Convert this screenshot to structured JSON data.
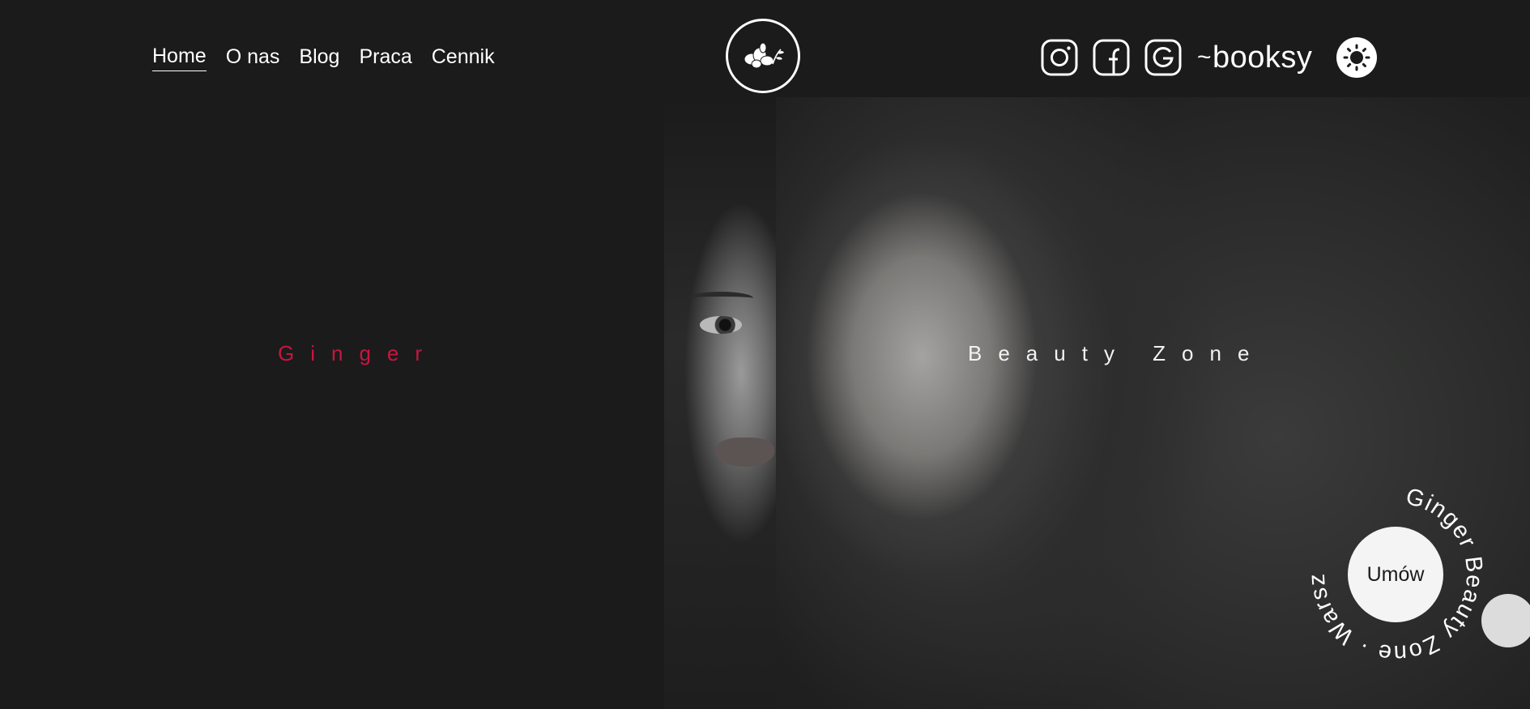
{
  "nav": {
    "items": [
      {
        "label": "Home",
        "active": true
      },
      {
        "label": "O nas",
        "active": false
      },
      {
        "label": "Blog",
        "active": false
      },
      {
        "label": "Praca",
        "active": false
      },
      {
        "label": "Cennik",
        "active": false
      }
    ]
  },
  "logo": {
    "icon": "ginger-root-logo-icon"
  },
  "socials": {
    "instagram": "instagram-icon",
    "facebook": "facebook-icon",
    "google": "google-icon",
    "booksy_label": "booksy"
  },
  "theme_toggle": {
    "icon": "sun-icon"
  },
  "hero": {
    "word_left": "Ginger",
    "word_right": "Beauty Zone"
  },
  "cta": {
    "button_label": "Umów",
    "ring_text": "Ginger Beauty Zone · Warszawa ."
  },
  "colors": {
    "background": "#1b1b1c",
    "accent": "#c8153f",
    "text": "#ffffff"
  }
}
